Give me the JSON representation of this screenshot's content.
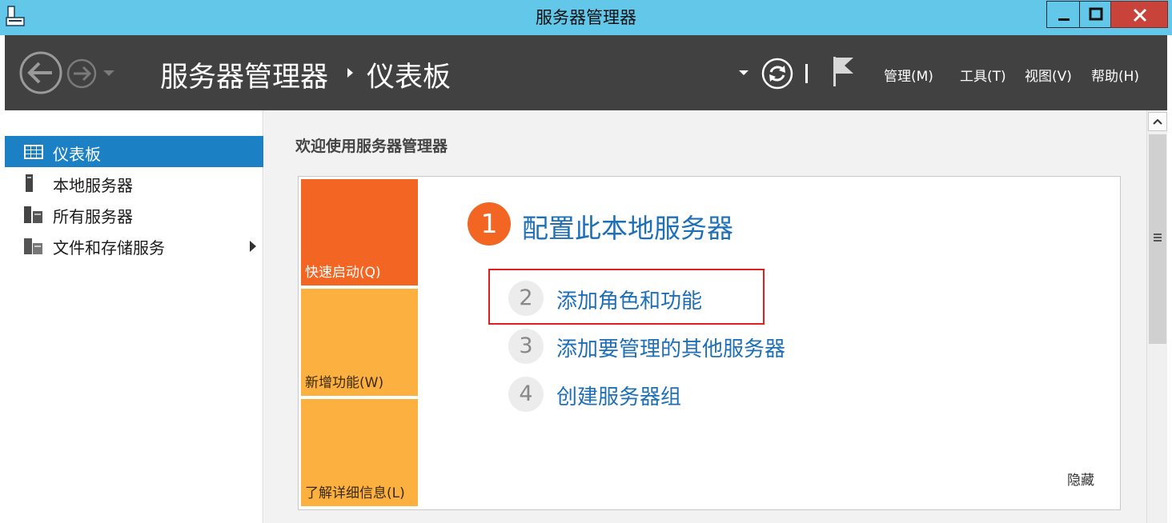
{
  "window": {
    "title": "服务器管理器"
  },
  "header": {
    "breadcrumb_root": "服务器管理器",
    "breadcrumb_current": "仪表板",
    "menus": [
      "管理(M)",
      "工具(T)",
      "视图(V)",
      "帮助(H)"
    ]
  },
  "sidebar": {
    "items": [
      {
        "label": "仪表板",
        "icon": "dashboard-icon",
        "selected": true
      },
      {
        "label": "本地服务器",
        "icon": "server-icon",
        "selected": false
      },
      {
        "label": "所有服务器",
        "icon": "servers-icon",
        "selected": false
      },
      {
        "label": "文件和存储服务",
        "icon": "storage-icon",
        "selected": false
      }
    ]
  },
  "main": {
    "welcome_title": "欢迎使用服务器管理器",
    "tiles": [
      "快速启动(Q)",
      "新增功能(W)",
      "了解详细信息(L)"
    ],
    "primary_step": {
      "number": "1",
      "label": "配置此本地服务器"
    },
    "steps": [
      {
        "number": "2",
        "label": "添加角色和功能"
      },
      {
        "number": "3",
        "label": "添加要管理的其他服务器"
      },
      {
        "number": "4",
        "label": "创建服务器组"
      }
    ],
    "hide_label": "隐藏"
  },
  "colors": {
    "title_bar": "#63c7ea",
    "header_band": "#414141",
    "selected_nav": "#1b80c4",
    "quick_start_tile": "#f26522",
    "secondary_tile": "#fbb040",
    "link": "#1d6fb8",
    "highlight": "#e02020"
  }
}
